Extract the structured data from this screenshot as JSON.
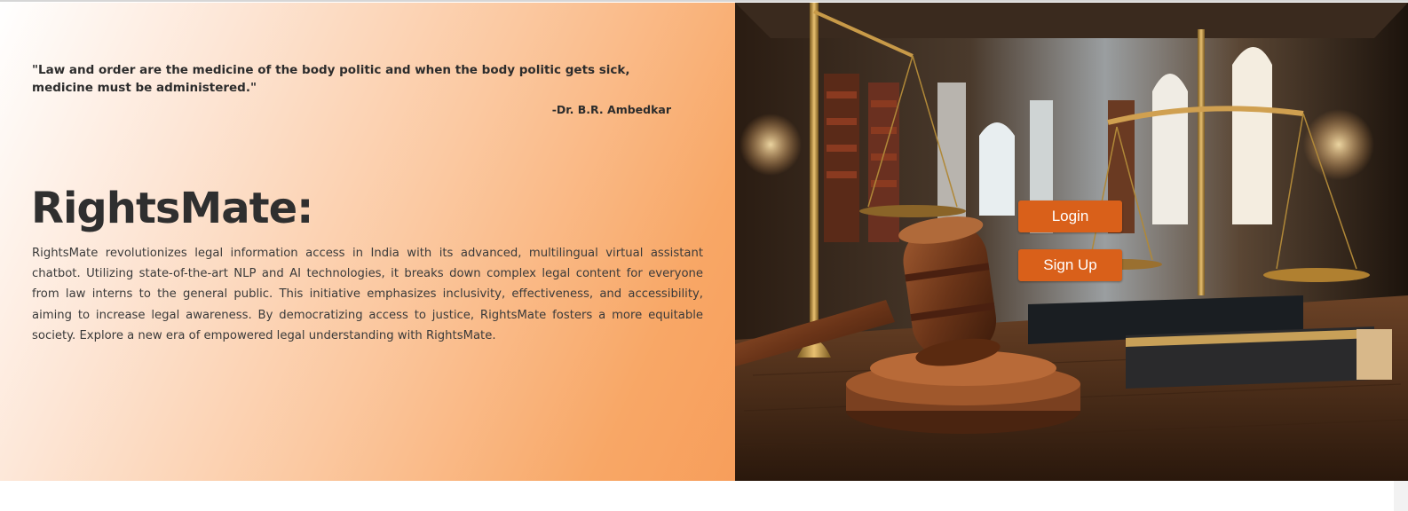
{
  "hero": {
    "quote": "\"Law and order are the medicine of the body politic and when the body politic gets sick, medicine must be administered.\"",
    "quote_author": "-Dr. B.R. Ambedkar",
    "title": "RightsMate:",
    "description": "RightsMate revolutionizes legal information access in India with its advanced, multilingual virtual assistant chatbot. Utilizing state-of-the-art NLP and AI technologies, it breaks down complex legal content for everyone from law interns to the general public. This initiative emphasizes inclusivity, effectiveness, and accessibility, aiming to increase legal awareness. By democratizing access to justice, RightsMate fosters a more equitable society. Explore a new era of empowered legal understanding with RightsMate."
  },
  "auth": {
    "login_label": "Login",
    "signup_label": "Sign Up"
  },
  "image": {
    "subject": "courtroom-gavel-and-scales-image"
  },
  "colors": {
    "accent": "#d9601a",
    "gradient_end": "#f79e5b"
  }
}
